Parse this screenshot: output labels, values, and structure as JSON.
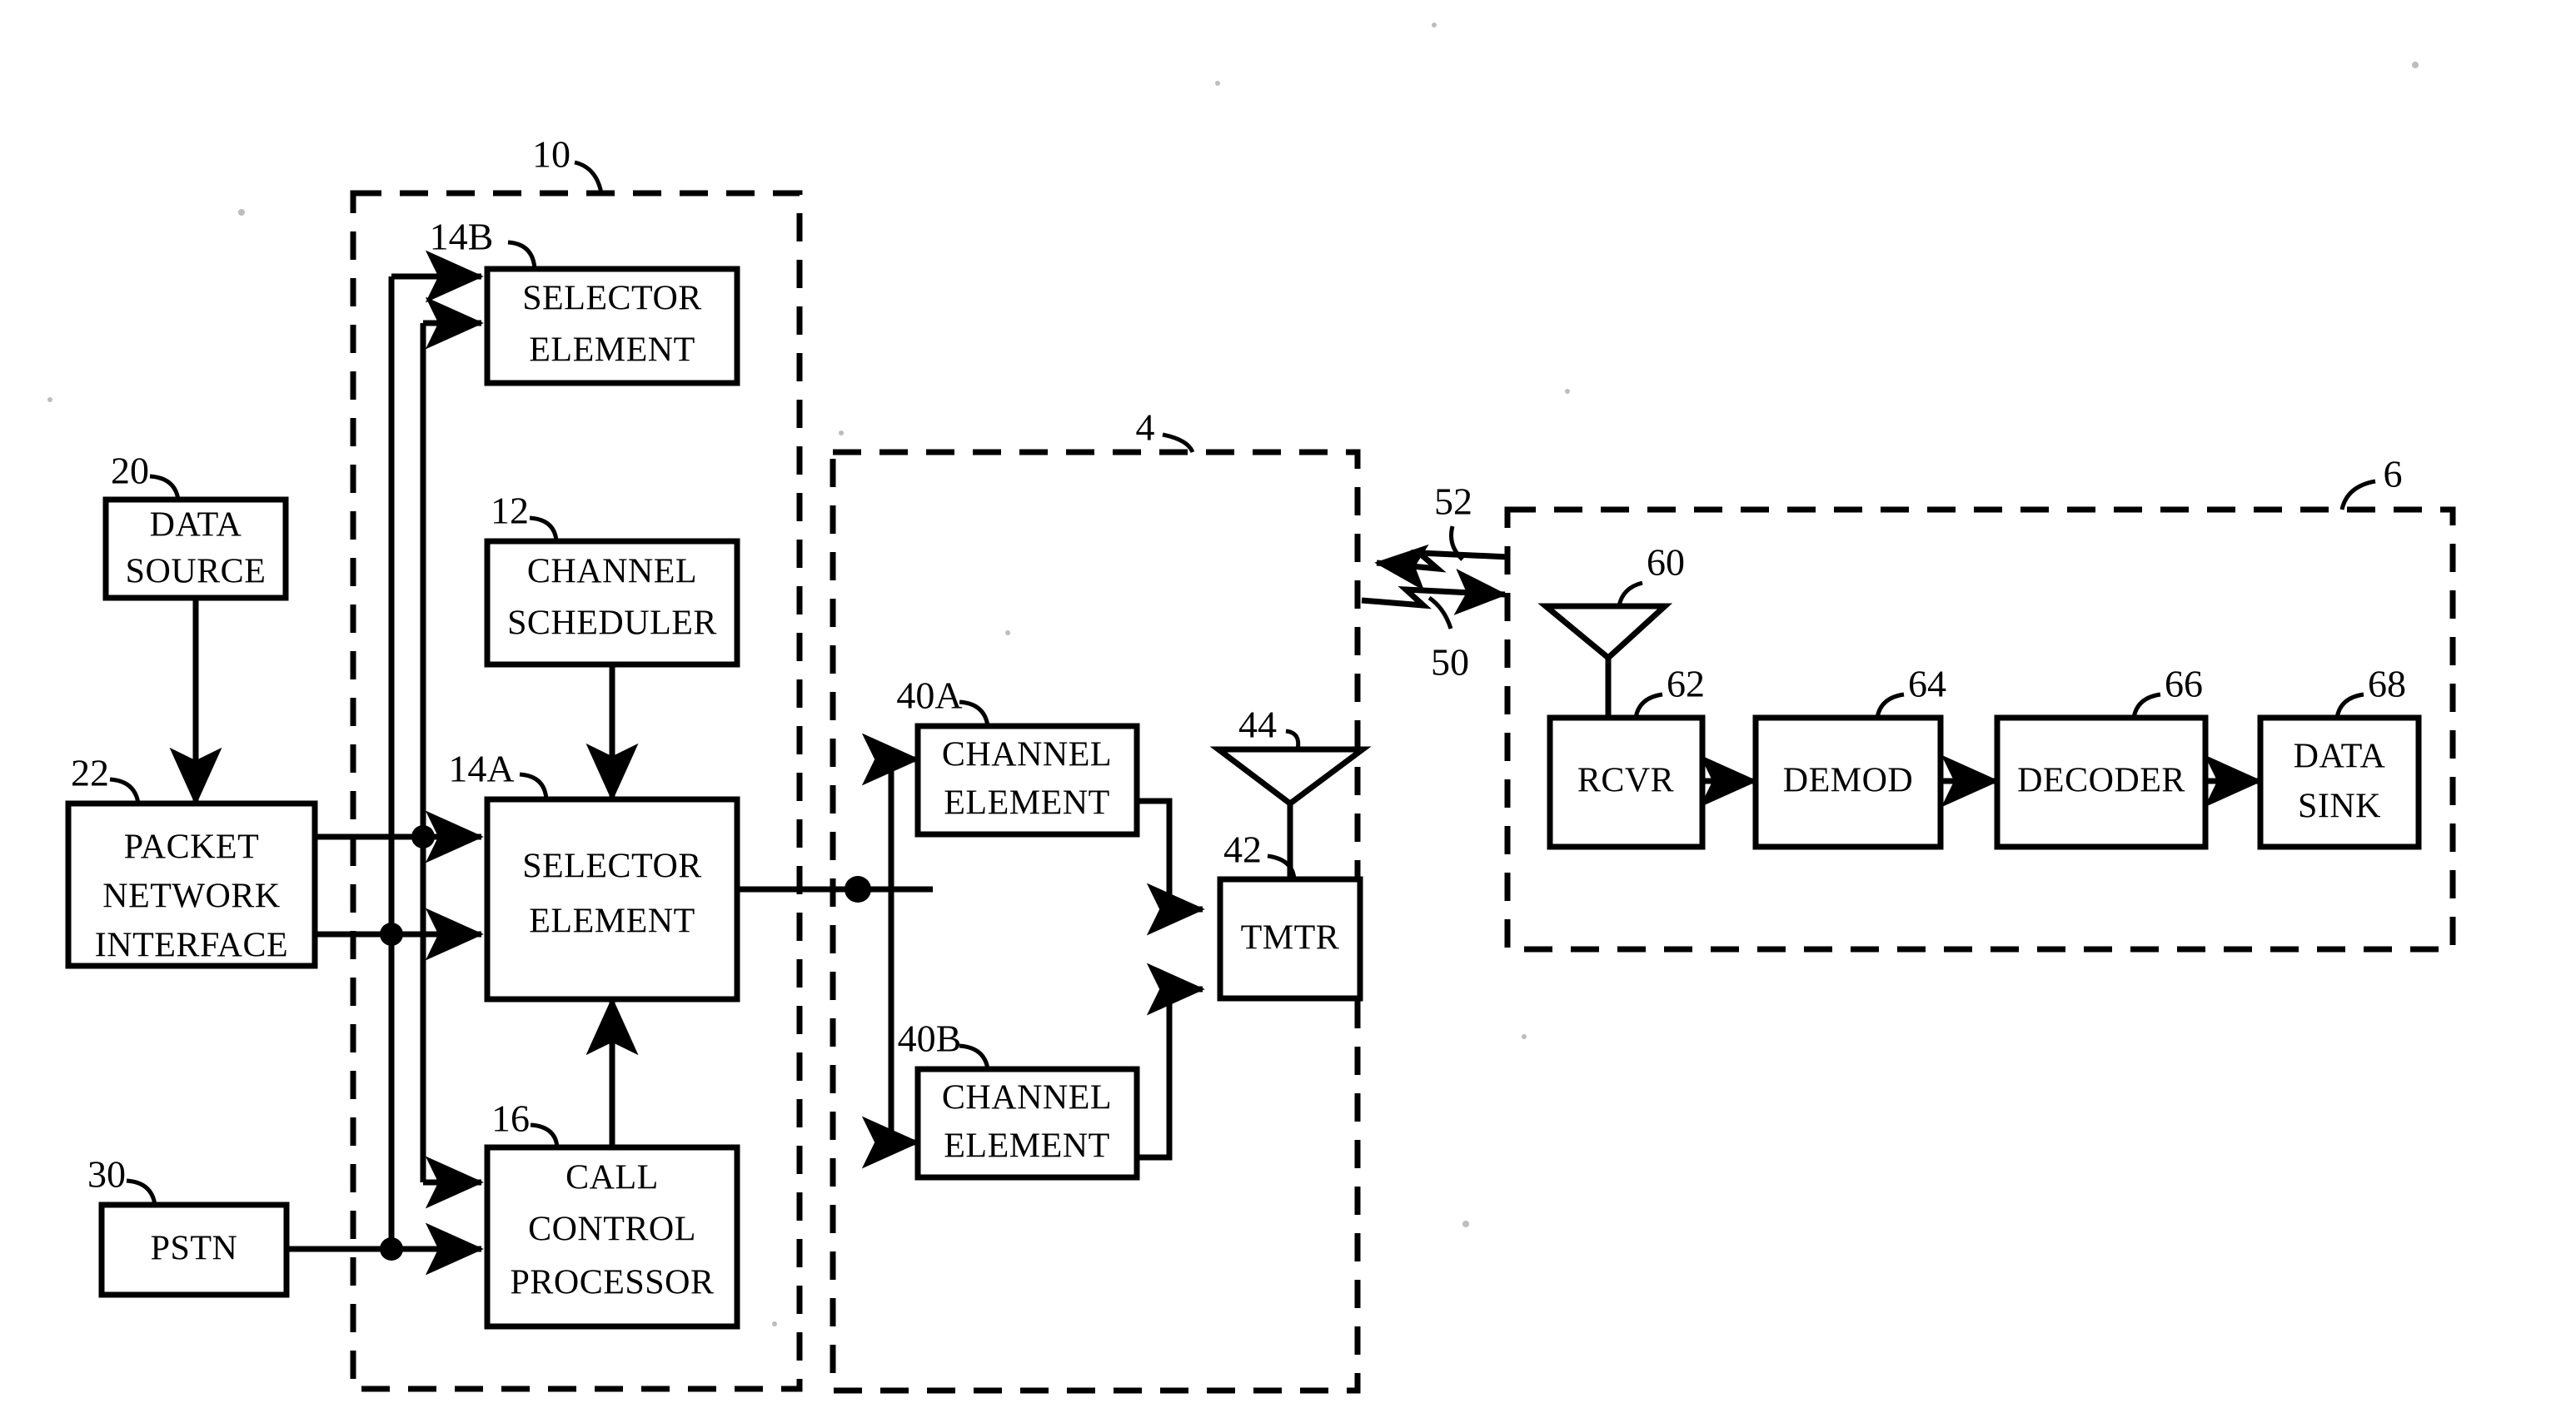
{
  "figure": {
    "type": "patent-block-diagram",
    "background_color": "#ffffff",
    "line_color": "#000000"
  },
  "enclosures": [
    {
      "id": "enc-10",
      "ref": "10",
      "style": "dashed",
      "contains": [
        "14B",
        "12",
        "14A",
        "16"
      ]
    },
    {
      "id": "enc-4",
      "ref": "4",
      "style": "dashed",
      "contains": [
        "40A",
        "40B",
        "42",
        "44"
      ]
    },
    {
      "id": "enc-6",
      "ref": "6",
      "style": "dashed",
      "contains": [
        "60",
        "62",
        "64",
        "66",
        "68"
      ]
    }
  ],
  "blocks": [
    {
      "id": "b-20",
      "ref": "20",
      "lines": [
        "DATA",
        "SOURCE"
      ]
    },
    {
      "id": "b-22",
      "ref": "22",
      "lines": [
        "PACKET",
        "NETWORK",
        "INTERFACE"
      ]
    },
    {
      "id": "b-30",
      "ref": "30",
      "lines": [
        "PSTN"
      ]
    },
    {
      "id": "b-14b",
      "ref": "14B",
      "lines": [
        "SELECTOR",
        "ELEMENT"
      ]
    },
    {
      "id": "b-12",
      "ref": "12",
      "lines": [
        "CHANNEL",
        "SCHEDULER"
      ]
    },
    {
      "id": "b-14a",
      "ref": "14A",
      "lines": [
        "SELECTOR",
        "ELEMENT"
      ]
    },
    {
      "id": "b-16",
      "ref": "16",
      "lines": [
        "CALL",
        "CONTROL",
        "PROCESSOR"
      ]
    },
    {
      "id": "b-40a",
      "ref": "40A",
      "lines": [
        "CHANNEL",
        "ELEMENT"
      ]
    },
    {
      "id": "b-40b",
      "ref": "40B",
      "lines": [
        "CHANNEL",
        "ELEMENT"
      ]
    },
    {
      "id": "b-42",
      "ref": "42",
      "lines": [
        "TMTR"
      ]
    },
    {
      "id": "b-62",
      "ref": "62",
      "lines": [
        "RCVR"
      ]
    },
    {
      "id": "b-64",
      "ref": "64",
      "lines": [
        "DEMOD"
      ]
    },
    {
      "id": "b-66",
      "ref": "66",
      "lines": [
        "DECODER"
      ]
    },
    {
      "id": "b-68",
      "ref": "68",
      "lines": [
        "DATA",
        "SINK"
      ]
    }
  ],
  "antennas": [
    {
      "id": "ant-44",
      "ref": "44"
    },
    {
      "id": "ant-60",
      "ref": "60"
    }
  ],
  "rf_links": [
    {
      "id": "rf-52",
      "ref": "52",
      "direction": "reverse-link"
    },
    {
      "id": "rf-50",
      "ref": "50",
      "direction": "forward-link"
    }
  ],
  "labels": {
    "data_source_l1": "DATA",
    "data_source_l2": "SOURCE",
    "packet_l1": "PACKET",
    "packet_l2": "NETWORK",
    "packet_l3": "INTERFACE",
    "pstn": "PSTN",
    "sel_b_l1": "SELECTOR",
    "sel_b_l2": "ELEMENT",
    "sched_l1": "CHANNEL",
    "sched_l2": "SCHEDULER",
    "sel_a_l1": "SELECTOR",
    "sel_a_l2": "ELEMENT",
    "ccp_l1": "CALL",
    "ccp_l2": "CONTROL",
    "ccp_l3": "PROCESSOR",
    "ce_a_l1": "CHANNEL",
    "ce_a_l2": "ELEMENT",
    "ce_b_l1": "CHANNEL",
    "ce_b_l2": "ELEMENT",
    "tmtr": "TMTR",
    "rcvr": "RCVR",
    "demod": "DEMOD",
    "decoder": "DECODER",
    "sink_l1": "DATA",
    "sink_l2": "SINK"
  },
  "refs": {
    "r4": "4",
    "r6": "6",
    "r10": "10",
    "r12": "12",
    "r14a": "14A",
    "r14b": "14B",
    "r16": "16",
    "r20": "20",
    "r22": "22",
    "r30": "30",
    "r40a": "40A",
    "r40b": "40B",
    "r42": "42",
    "r44": "44",
    "r50": "50",
    "r52": "52",
    "r60": "60",
    "r62": "62",
    "r64": "64",
    "r66": "66",
    "r68": "68"
  }
}
